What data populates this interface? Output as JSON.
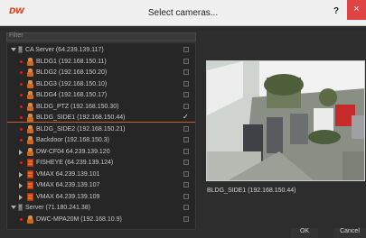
{
  "window": {
    "logo_text": "DW",
    "title": "Select cameras...",
    "help_label": "?",
    "close_label": "×"
  },
  "filter": {
    "placeholder": "Filter"
  },
  "tree": [
    {
      "kind": "server",
      "label": "CA Server (64.239.139.117)",
      "expanded": true,
      "indent": 0,
      "checked": false
    },
    {
      "kind": "camera",
      "label": "BLDG1 (192.168.150.11)",
      "indent": 1,
      "checked": false
    },
    {
      "kind": "camera",
      "label": "BLDG2 (192.168.150.20)",
      "indent": 1,
      "checked": false
    },
    {
      "kind": "camera",
      "label": "BLDG3 (192.168.150.10)",
      "indent": 1,
      "checked": false
    },
    {
      "kind": "camera",
      "label": "BLDG4 (192.168.150.17)",
      "indent": 1,
      "checked": false
    },
    {
      "kind": "camera",
      "label": "BLDG_PTZ (192.168.150.30)",
      "indent": 1,
      "checked": false
    },
    {
      "kind": "camera",
      "label": "BLDG_SIDE1 (192.168.150.44)",
      "indent": 1,
      "checked": true,
      "selected": true
    },
    {
      "kind": "camera",
      "label": "BLDG_SIDE2 (192.168.150.21)",
      "indent": 1,
      "checked": false
    },
    {
      "kind": "camera",
      "label": "Backdoor (192.168.150.3)",
      "indent": 1,
      "checked": false
    },
    {
      "kind": "camera",
      "label": "DW-CF04 64.239.139.120",
      "indent": 1,
      "checked": false,
      "expandable": true
    },
    {
      "kind": "grid",
      "label": "FISHEYE (64.239.139.124)",
      "indent": 1,
      "checked": false
    },
    {
      "kind": "grid",
      "label": "VMAX 64.239.139.101",
      "indent": 1,
      "checked": false,
      "expandable": true
    },
    {
      "kind": "grid",
      "label": "VMAX 64.239.139.107",
      "indent": 1,
      "checked": false,
      "expandable": true
    },
    {
      "kind": "grid",
      "label": "VMAX 64.239.139.109",
      "indent": 1,
      "checked": false,
      "expandable": true
    },
    {
      "kind": "server",
      "label": "Server (71.180.241.38)",
      "expanded": true,
      "indent": 0,
      "checked": false
    },
    {
      "kind": "camera",
      "label": "DWC-MPA20M (192.168.10.9)",
      "indent": 1,
      "checked": false
    }
  ],
  "preview": {
    "caption": "BLDG_SIDE1 (192.168.150.44)"
  },
  "buttons": {
    "ok": "OK",
    "cancel": "Cancel"
  },
  "colors": {
    "accent": "#c9602c",
    "close": "#e04343",
    "status_dot": "#d82020"
  }
}
